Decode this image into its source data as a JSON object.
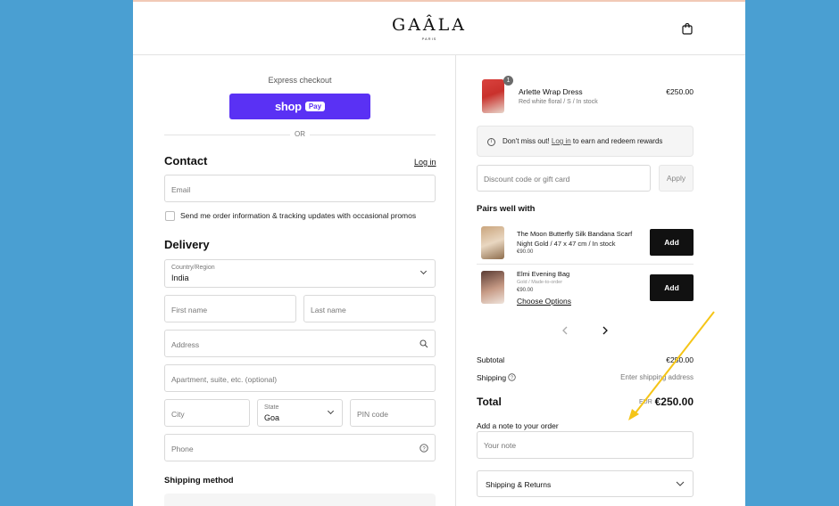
{
  "header": {
    "brand": "GAÂLA",
    "brand_sub": "PARIS"
  },
  "checkout": {
    "express_label": "Express checkout",
    "shop_pay": {
      "shop_text": "shop",
      "pay_text": "Pay"
    },
    "or_label": "OR",
    "contact": {
      "title": "Contact",
      "login_link": "Log in",
      "email_placeholder": "Email",
      "promo_checkbox_label": "Send me order information & tracking updates with occasional promos"
    },
    "delivery": {
      "title": "Delivery",
      "country_label": "Country/Region",
      "country_value": "India",
      "first_name_placeholder": "First name",
      "last_name_placeholder": "Last name",
      "address_placeholder": "Address",
      "apartment_placeholder": "Apartment, suite, etc. (optional)",
      "city_placeholder": "City",
      "state_label": "State",
      "state_value": "Goa",
      "pin_placeholder": "PIN code",
      "phone_placeholder": "Phone"
    },
    "shipping_method_title": "Shipping method"
  },
  "summary": {
    "item": {
      "name": "Arlette Wrap Dress",
      "meta": "Red white floral / S / In stock",
      "price": "€250.00",
      "quantity": "1"
    },
    "notice": {
      "prefix": "Don't miss out! ",
      "link": "Log in",
      "suffix": " to earn and redeem rewards"
    },
    "discount_placeholder": "Discount code or gift card",
    "apply_label": "Apply",
    "pairs_title": "Pairs well with",
    "recommendations": [
      {
        "name": "The Moon Butterfly Silk Bandana Scarf",
        "meta": "Night Gold / 47 x 47 cm / In stock",
        "price": "€90.00",
        "button": "Add"
      },
      {
        "name": "Elmi Evening Bag",
        "meta": "Gold / Made-to-order",
        "price": "€90.00",
        "options_link": "Choose Options",
        "button": "Add"
      }
    ],
    "subtotal_label": "Subtotal",
    "subtotal_value": "€250.00",
    "shipping_label": "Shipping",
    "shipping_value": "Enter shipping address",
    "total_label": "Total",
    "total_currency": "EUR",
    "total_value": "€250.00",
    "note_label": "Add a note to your order",
    "note_placeholder": "Your note",
    "shipping_returns_label": "Shipping & Returns"
  },
  "colors": {
    "shop_pay": "#5a31f4",
    "background": "#4a9fd2",
    "annotation_arrow": "#f5c518"
  }
}
